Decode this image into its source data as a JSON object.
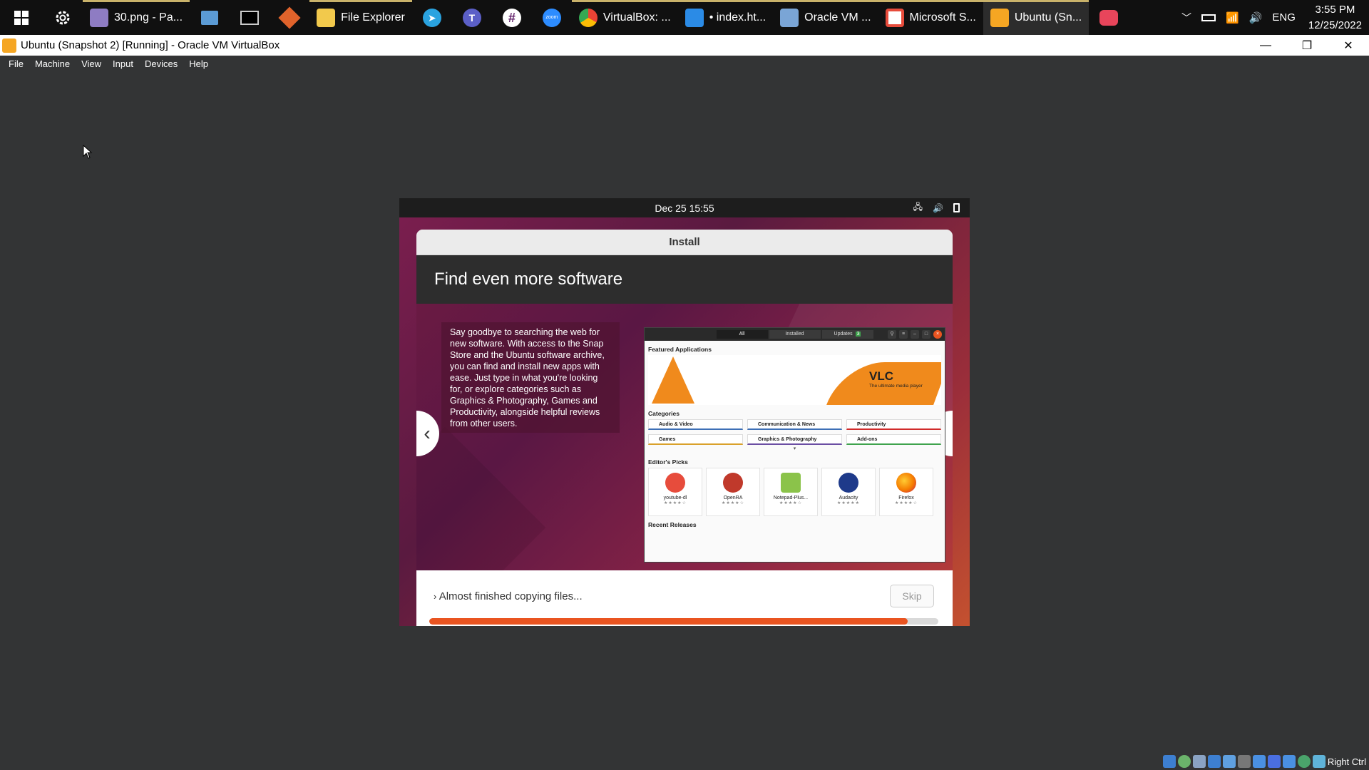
{
  "taskbar": {
    "apps": [
      {
        "label": "30.png - Pa...",
        "color": "#8e7cc3"
      },
      {
        "label": "File Explorer",
        "color": "#f2c94c"
      },
      {
        "label": "VirtualBox: ...",
        "color": "#4285f4"
      },
      {
        "label": "• index.ht...",
        "color": "#2b8be6"
      },
      {
        "label": "Oracle VM ...",
        "color": "#7aa5d6"
      },
      {
        "label": "Microsoft S...",
        "color": "#e74c3c"
      },
      {
        "label": "Ubuntu (Sn...",
        "color": "#f5a623"
      }
    ],
    "tray_lang": "ENG",
    "clock_time": "3:55 PM",
    "clock_date": "12/25/2022"
  },
  "window": {
    "title": "Ubuntu (Snapshot 2) [Running] - Oracle VM VirtualBox"
  },
  "menu": [
    "File",
    "Machine",
    "View",
    "Input",
    "Devices",
    "Help"
  ],
  "vm": {
    "clock": "Dec 25  15:55",
    "installer": {
      "header": "Install",
      "banner": "Find even more software",
      "description": "Say goodbye to searching the web for new software. With access to the Snap Store and the Ubuntu software archive, you can find and install new apps with ease. Just type in what you're looking for, or explore categories such as Graphics & Photography, Games and Productivity, alongside helpful reviews from other users.",
      "status": "Almost finished copying files...",
      "skip_label": "Skip",
      "progress": 0.94
    },
    "store": {
      "tabs": [
        "All",
        "Installed",
        "Updates"
      ],
      "updates_count": "3",
      "featured_title": "Featured Applications",
      "featured_app": "VLC",
      "featured_tagline": "The ultimate media player",
      "categories_title": "Categories",
      "categories": [
        "Audio & Video",
        "Communication & News",
        "Productivity",
        "Games",
        "Graphics & Photography",
        "Add-ons"
      ],
      "picks_title": "Editor's Picks",
      "picks": [
        {
          "name": "youtube-dl",
          "rating": "★★★★☆",
          "color": "#e74c3c"
        },
        {
          "name": "OpenRA",
          "rating": "★★★★☆",
          "color": "#c0392b"
        },
        {
          "name": "Notepad-Plus...",
          "rating": "★★★★☆",
          "color": "#8bc34a"
        },
        {
          "name": "Audacity",
          "rating": "★★★★★",
          "color": "#1e3a8a"
        },
        {
          "name": "Firefox",
          "rating": "★★★★☆",
          "color": "#f57c00"
        }
      ],
      "recent_title": "Recent Releases"
    }
  },
  "status_bar": {
    "host_key": "Right Ctrl"
  }
}
